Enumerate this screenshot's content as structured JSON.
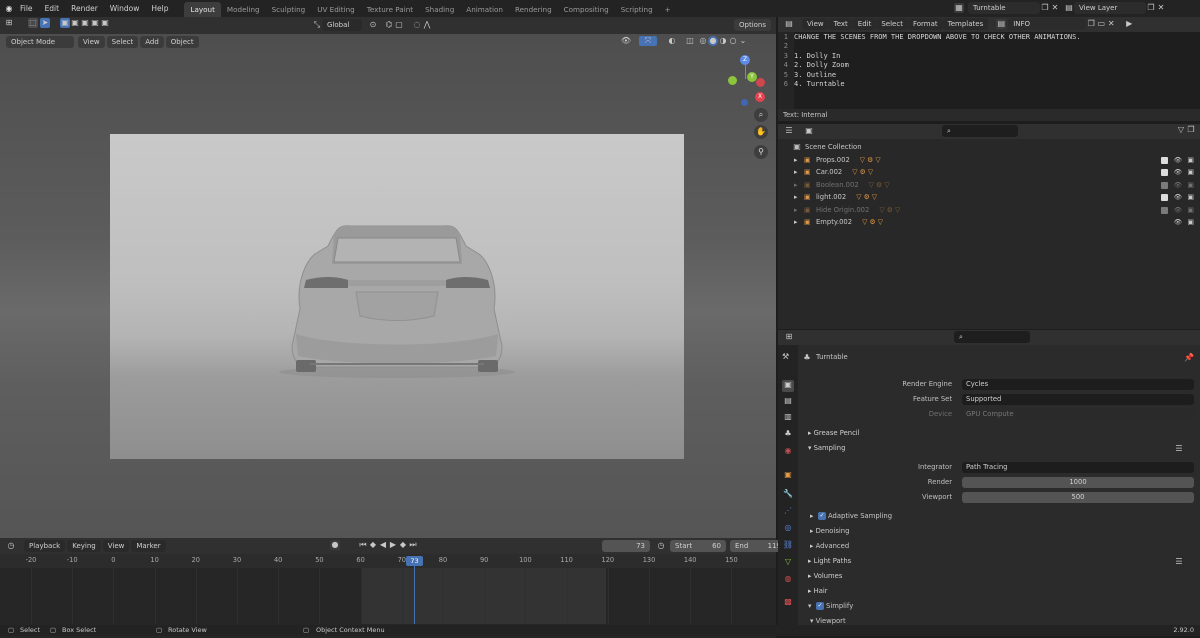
{
  "topbar": {
    "menus": [
      "File",
      "Edit",
      "Render",
      "Window",
      "Help"
    ],
    "workspace_tabs": [
      "Layout",
      "Modeling",
      "Sculpting",
      "UV Editing",
      "Texture Paint",
      "Shading",
      "Animation",
      "Rendering",
      "Compositing",
      "Scripting"
    ],
    "active_tab": "Layout",
    "add_tab": "+",
    "scene_name": "Turntable",
    "view_layer": "View Layer"
  },
  "viewport": {
    "mode": "Object Mode",
    "menus": [
      "View",
      "Select",
      "Add",
      "Object"
    ],
    "transform_orientation": "Global",
    "options_label": "Options",
    "gizmo": {
      "z": "Z",
      "y": "Y",
      "x": "X"
    }
  },
  "text_editor": {
    "menus": [
      "View",
      "Text",
      "Edit",
      "Select",
      "Format",
      "Templates"
    ],
    "file_name": "INFO",
    "lines": [
      {
        "num": "1",
        "text": "CHANGE THE SCENES FROM THE DROPDOWN ABOVE TO CHECK OTHER ANIMATIONS."
      },
      {
        "num": "2",
        "text": ""
      },
      {
        "num": "3",
        "text": "1. Dolly In"
      },
      {
        "num": "4",
        "text": "2. Dolly Zoom"
      },
      {
        "num": "5",
        "text": "3. Outline"
      },
      {
        "num": "6",
        "text": "4. Turntable"
      }
    ],
    "footer": "Text: Internal"
  },
  "outliner": {
    "root": "Scene Collection",
    "items": [
      {
        "name": "Props.002",
        "dim": false,
        "expand": "▸"
      },
      {
        "name": "Car.002",
        "dim": false,
        "expand": "▸"
      },
      {
        "name": "Boolean.002",
        "dim": true,
        "expand": "▸"
      },
      {
        "name": "light.002",
        "dim": false,
        "expand": "▸"
      },
      {
        "name": "Hide Origin.002",
        "dim": true,
        "expand": "▸"
      },
      {
        "name": "Empty.002",
        "dim": false,
        "expand": "▸"
      }
    ]
  },
  "properties": {
    "scene": "Turntable",
    "render_engine_label": "Render Engine",
    "render_engine": "Cycles",
    "feature_set_label": "Feature Set",
    "feature_set": "Supported",
    "device_label": "Device",
    "device": "GPU Compute",
    "grease_pencil": "Grease Pencil",
    "sampling": "Sampling",
    "integrator_label": "Integrator",
    "integrator": "Path Tracing",
    "render_label": "Render",
    "render_samples": "1000",
    "viewport_label": "Viewport",
    "viewport_samples": "500",
    "adaptive_sampling": "Adaptive Sampling",
    "denoising": "Denoising",
    "advanced": "Advanced",
    "light_paths": "Light Paths",
    "volumes": "Volumes",
    "hair": "Hair",
    "simplify": "Simplify",
    "simplify_viewport": "Viewport"
  },
  "timeline": {
    "menus": [
      "Playback",
      "Keying",
      "View",
      "Marker"
    ],
    "current_frame": "73",
    "start_label": "Start",
    "start": "60",
    "end_label": "End",
    "end": "119",
    "ruler": [
      "-20",
      "-10",
      "0",
      "10",
      "20",
      "30",
      "40",
      "50",
      "60",
      "70",
      "80",
      "90",
      "100",
      "110",
      "120",
      "130",
      "140",
      "150"
    ],
    "playhead": "73"
  },
  "statusbar": {
    "select": "Select",
    "box_select": "Box Select",
    "rotate_view": "Rotate View",
    "context_menu": "Object Context Menu",
    "version": "2.92.0"
  },
  "colors": {
    "accent": "#4772b3",
    "x_axis": "#e4444f",
    "y_axis": "#8cc43b",
    "z_axis": "#5c8be8",
    "icon_orange": "#e09a4a"
  }
}
